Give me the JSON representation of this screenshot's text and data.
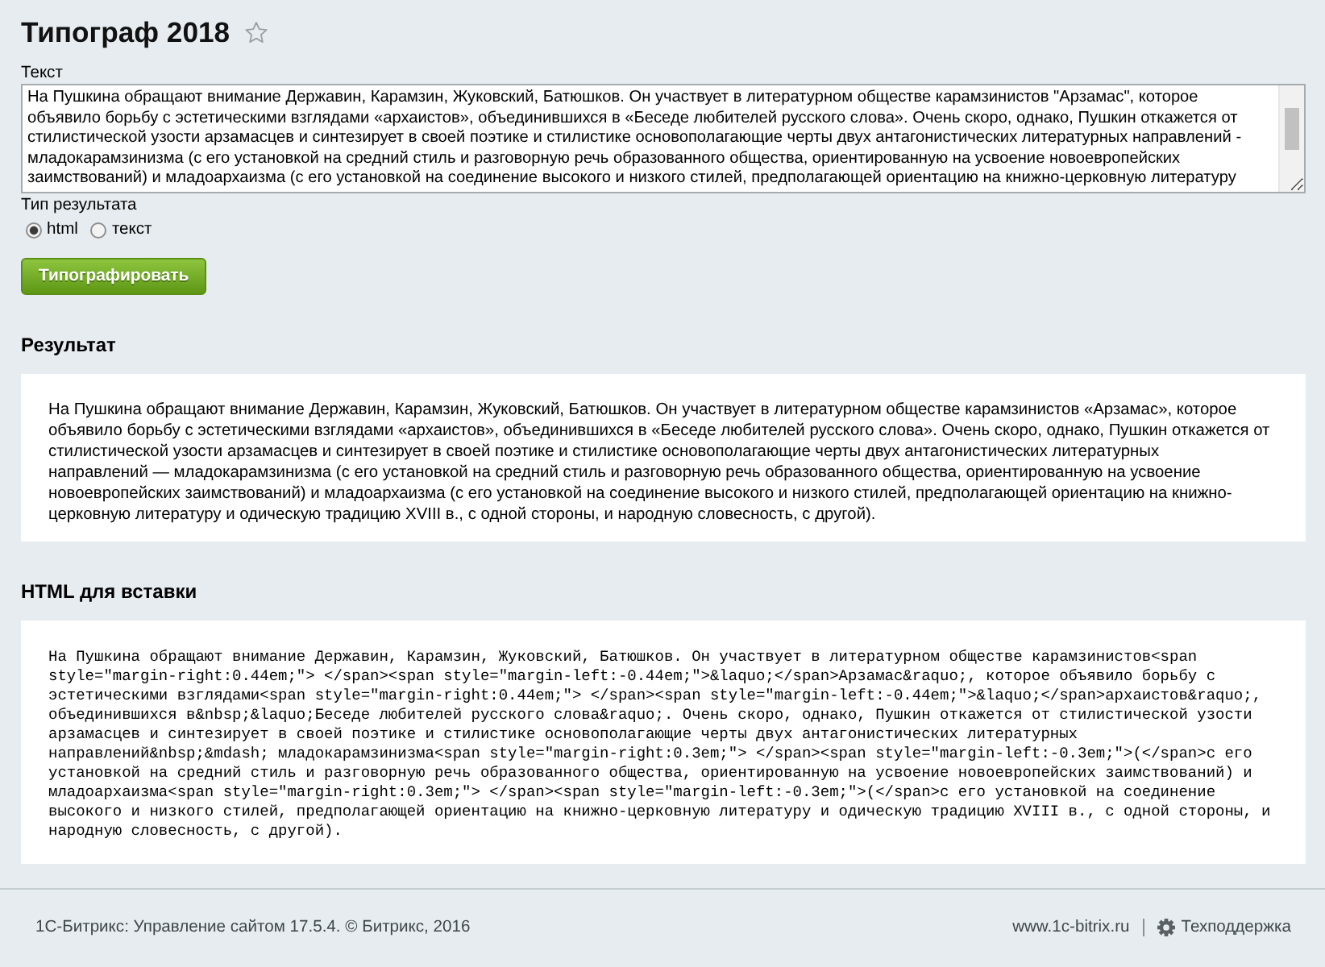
{
  "page": {
    "title": "Типограф 2018",
    "starred": false
  },
  "form": {
    "text_field": {
      "label": "Текст",
      "value": "На Пушкина обращают внимание Державин, Карамзин, Жуковский, Батюшков. Он участвует в литературном обществе карамзинистов \"Арзамас\", которое объявило борьбу с эстетическими взглядами «архаистов», объединившихся в «Беседе любителей русского слова». Очень скоро, однако, Пушкин откажется от стилистической узости арзамасцев и синтезирует в своей поэтике и стилистике основополагающие черты двух антагонистических литературных направлений - младокарамзинизма (с его установкой на средний стиль и разговорную речь образованного общества, ориентированную на усвоение новоевропейских заимствований) и младоархаизма (с его установкой на соединение высокого и низкого стилей, предполагающей ориентацию на книжно-церковную литературу"
    },
    "result_type": {
      "label": "Тип результата",
      "options": [
        {
          "label": "html",
          "selected": true
        },
        {
          "label": "текст",
          "selected": false
        }
      ]
    },
    "submit_button": "Типографировать"
  },
  "result": {
    "heading": "Результат",
    "text": "На Пушкина обращают внимание Державин, Карамзин, Жуковский, Батюшков. Он участвует в литературном обществе карамзинистов «Арзамас», которое объявило борьбу с эстетическими взглядами «архаистов», объединившихся в «Беседе любителей русского слова». Очень скоро, однако, Пушкин откажется от стилистической узости арзамасцев и синтезирует в своей поэтике и стилистике основополагающие черты двух антагонистических литературных направлений — младокарамзинизма (с его установкой на средний стиль и разговорную речь образованного общества, ориентированную на усвоение новоевропейских заимствований) и младоархаизма (с его установкой на соединение высокого и низкого стилей, предполагающей ориентацию на книжно-церковную литературу и одическую традицию XVIII в., с одной стороны, и народную словесность, с другой)."
  },
  "html_output": {
    "heading": "HTML для вставки",
    "code": "На Пушкина обращают внимание Державин, Карамзин, Жуковский, Батюшков. Он участвует в литературном обществе карамзинистов<span style=\"margin-right:0.44em;\"> </span><span style=\"margin-left:-0.44em;\">&laquo;</span>Арзамас&raquo;, которое объявило борьбу с эстетическими взглядами<span style=\"margin-right:0.44em;\"> </span><span style=\"margin-left:-0.44em;\">&laquo;</span>архаистов&raquo;, объединившихся в&nbsp;&laquo;Беседе любителей русского слова&raquo;. Очень скоро, однако, Пушкин откажется от стилистической узости арзамасцев и синтезирует в своей поэтике и стилистике основополагающие черты двух антагонистических литературных направлений&nbsp;&mdash; младокарамзинизма<span style=\"margin-right:0.3em;\"> </span><span style=\"margin-left:-0.3em;\">(</span>с его установкой на средний стиль и разговорную речь образованного общества, ориентированную на усвоение новоевропейских заимствований) и младоархаизма<span style=\"margin-right:0.3em;\"> </span><span style=\"margin-left:-0.3em;\">(</span>с его установкой на соединение высокого и низкого стилей, предполагающей ориентацию на книжно-церковную литературу и одическую традицию XVIII в., с одной стороны, и народную словесность, с другой)."
  },
  "footer": {
    "copyright": "1С-Битрикс: Управление сайтом 17.5.4. © Битрикс, 2016",
    "links": [
      {
        "kind": "site",
        "label": "www.1c-bitrix.ru"
      },
      {
        "kind": "support",
        "label": "Техподдержка"
      }
    ]
  }
}
